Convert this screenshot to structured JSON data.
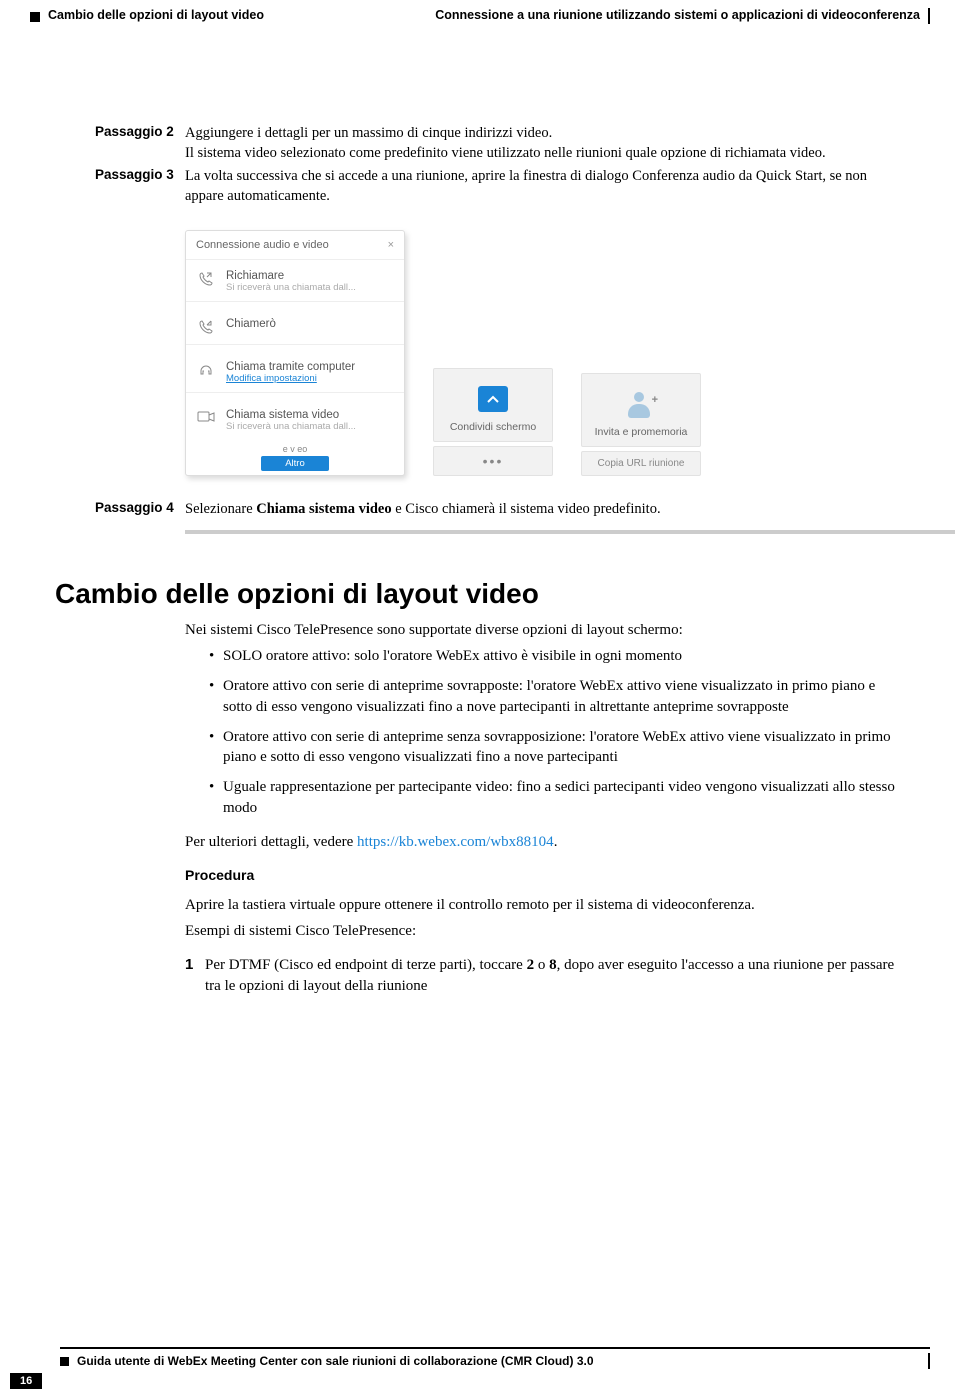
{
  "header": {
    "left": "Cambio delle opzioni di layout video",
    "right": "Connessione a una riunione utilizzando sistemi o applicazioni di videoconferenza"
  },
  "steps": {
    "s2": {
      "label": "Passaggio 2",
      "line1": "Aggiungere i dettagli per un massimo di cinque indirizzi video.",
      "line2": "Il sistema video selezionato come predefinito viene utilizzato nelle riunioni quale opzione di richiamata video."
    },
    "s3": {
      "label": "Passaggio 3",
      "text": "La volta successiva che si accede a una riunione, aprire la finestra di dialogo Conferenza audio da Quick Start, se non appare automaticamente."
    },
    "s4": {
      "label": "Passaggio 4",
      "pre": "Selezionare ",
      "emph": "Chiama sistema video",
      "post": " e Cisco chiamerà il sistema video predefinito."
    }
  },
  "dialog": {
    "title": "Connessione audio e video",
    "close": "×",
    "opt1": {
      "title": "Richiamare",
      "sub": "Si riceverà una chiamata dall..."
    },
    "opt2": {
      "title": "Chiamerò"
    },
    "opt3": {
      "title": "Chiama tramite computer",
      "link": "Modifica impostazioni"
    },
    "opt4": {
      "title": "Chiama sistema video",
      "sub": "Si riceverà una chiamata dall..."
    },
    "foot_tiny": "e v eo",
    "foot_btn": "Altro"
  },
  "tiles": {
    "share": "Condividi schermo",
    "share_sub": "•••",
    "invite": "Invita e promemoria",
    "invite_sub": "Copia URL riunione"
  },
  "section": {
    "title": "Cambio delle opzioni di layout video",
    "intro": "Nei sistemi Cisco TelePresence sono supportate diverse opzioni di layout schermo:",
    "b1": "SOLO oratore attivo: solo l'oratore WebEx attivo è visibile in ogni momento",
    "b2": "Oratore attivo con serie di anteprime sovrapposte: l'oratore WebEx attivo viene visualizzato in primo piano e sotto di esso vengono visualizzati fino a nove partecipanti in altrettante anteprime sovrapposte",
    "b3": "Oratore attivo con serie di anteprime senza sovrapposizione: l'oratore WebEx attivo viene visualizzato in primo piano e sotto di esso vengono visualizzati fino a nove partecipanti",
    "b4": "Uguale rappresentazione per partecipante video: fino a sedici partecipanti video vengono visualizzati allo stesso modo",
    "more_pre": "Per ulteriori dettagli, vedere ",
    "more_link": "https://kb.webex.com/wbx88104",
    "more_post": ".",
    "proc_h": "Procedura",
    "proc_intro1": "Aprire la tastiera virtuale oppure ottenere il controllo remoto per il sistema di videoconferenza.",
    "proc_intro2": "Esempi di sistemi Cisco TelePresence:",
    "proc1_num": "1",
    "proc1_pre": "Per DTMF (Cisco ed endpoint di terze parti), toccare ",
    "proc1_b1": "2",
    "proc1_mid": " o ",
    "proc1_b2": "8",
    "proc1_post": ", dopo aver eseguito l'accesso a una riunione per passare tra le opzioni di layout della riunione"
  },
  "footer": {
    "title": "Guida utente di WebEx Meeting Center con sale riunioni di collaborazione (CMR Cloud) 3.0",
    "page": "16"
  }
}
